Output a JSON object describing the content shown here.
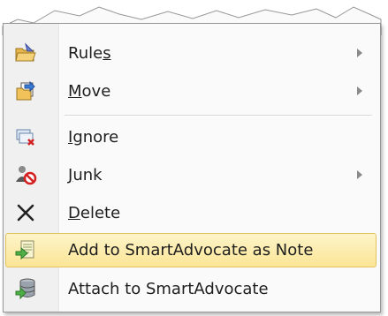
{
  "menu": {
    "items": [
      {
        "label": "Rules",
        "access_key": "s",
        "icon": "rules-folder-icon",
        "submenu": true
      },
      {
        "label": "Move",
        "access_key": "M",
        "icon": "move-folder-icon",
        "submenu": true
      },
      {
        "label": "Ignore",
        "access_key": "I",
        "icon": "ignore-conversation-icon",
        "submenu": false
      },
      {
        "label": "Junk",
        "access_key": "J",
        "icon": "junk-mail-icon",
        "submenu": true
      },
      {
        "label": "Delete",
        "access_key": "D",
        "icon": "delete-x-icon",
        "submenu": false
      },
      {
        "label": "Add to SmartAdvocate as Note",
        "icon": "add-note-icon",
        "submenu": false,
        "highlighted": true
      },
      {
        "label": "Attach to SmartAdvocate",
        "icon": "attach-database-icon",
        "submenu": false
      }
    ]
  },
  "colors": {
    "highlight_top": "#fdf4c8",
    "highlight_bottom": "#fbe596",
    "highlight_border": "#e3c25e",
    "menu_border": "#979797",
    "gutter": "#f0f0f0"
  }
}
